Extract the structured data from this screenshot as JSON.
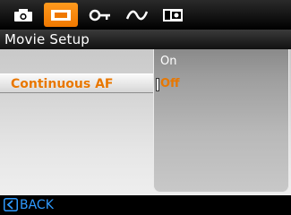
{
  "tabs": [
    {
      "icon": "camera-icon",
      "active": false
    },
    {
      "icon": "movie-icon",
      "active": true
    },
    {
      "icon": "key-icon",
      "active": false
    },
    {
      "icon": "wave-icon",
      "active": false
    },
    {
      "icon": "playback-icon",
      "active": false
    }
  ],
  "title": "Movie Setup",
  "menu": {
    "items": [
      {
        "label": "Continuous AF",
        "selected": true
      }
    ]
  },
  "options": {
    "items": [
      {
        "label": "On",
        "selected": false
      },
      {
        "label": "Off",
        "selected": true
      }
    ]
  },
  "footer": {
    "back_label": "BACK",
    "back_icon": "back-arrow-icon"
  },
  "colors": {
    "accent": "#e87700",
    "tab_active": "#f07800",
    "back_text": "#2f9bff"
  }
}
